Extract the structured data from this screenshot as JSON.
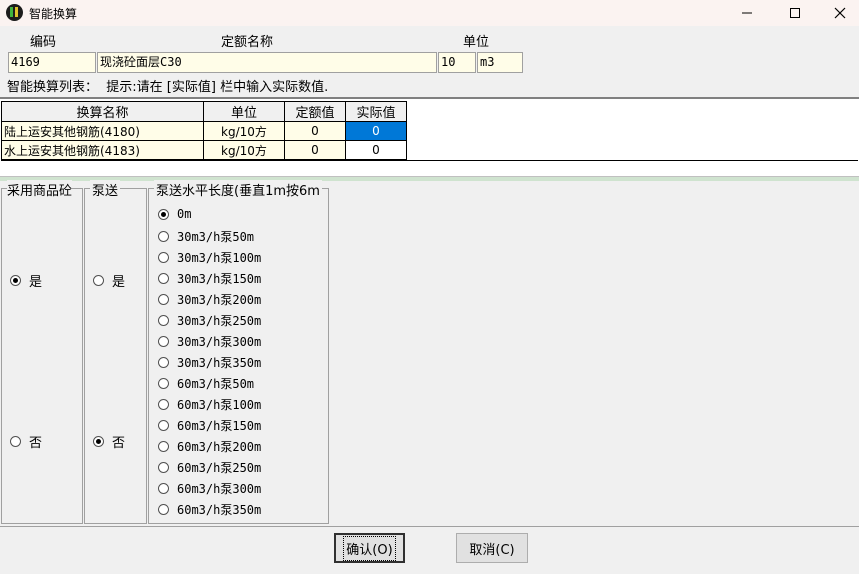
{
  "window": {
    "title": "智能换算"
  },
  "header": {
    "code_label": "编码",
    "name_label": "定额名称",
    "unit_label": "单位",
    "code_value": "4169",
    "name_value": "现浇砼面层C30",
    "qty_value": "10",
    "unit_value": "m3"
  },
  "hint": {
    "list_label": "智能换算列表：",
    "tip": "提示:请在 [实际值] 栏中输入实际数值."
  },
  "grid": {
    "columns": [
      "换算名称",
      "单位",
      "定额值",
      "实际值"
    ],
    "rows": [
      {
        "name": "陆上运安其他钢筋(4180)",
        "unit": "kg/10方",
        "quota": "0",
        "actual": "0",
        "selected": true
      },
      {
        "name": "水上运安其他钢筋(4183)",
        "unit": "kg/10方",
        "quota": "0",
        "actual": "0",
        "selected": false
      }
    ]
  },
  "groups": {
    "commercial": {
      "title": "采用商品砼",
      "yes": "是",
      "no": "否",
      "selected": "yes"
    },
    "pump": {
      "title": "泵送",
      "yes": "是",
      "no": "否",
      "selected": "no"
    },
    "distance": {
      "title": "泵送水平长度(垂直1m按6m",
      "options": [
        "0m",
        "30m3/h泵50m",
        "30m3/h泵100m",
        "30m3/h泵150m",
        "30m3/h泵200m",
        "30m3/h泵250m",
        "30m3/h泵300m",
        "30m3/h泵350m",
        "60m3/h泵50m",
        "60m3/h泵100m",
        "60m3/h泵150m",
        "60m3/h泵200m",
        "60m3/h泵250m",
        "60m3/h泵300m",
        "60m3/h泵350m"
      ],
      "selected_index": 0
    }
  },
  "buttons": {
    "ok": "确认(O)",
    "cancel": "取消(C)"
  }
}
